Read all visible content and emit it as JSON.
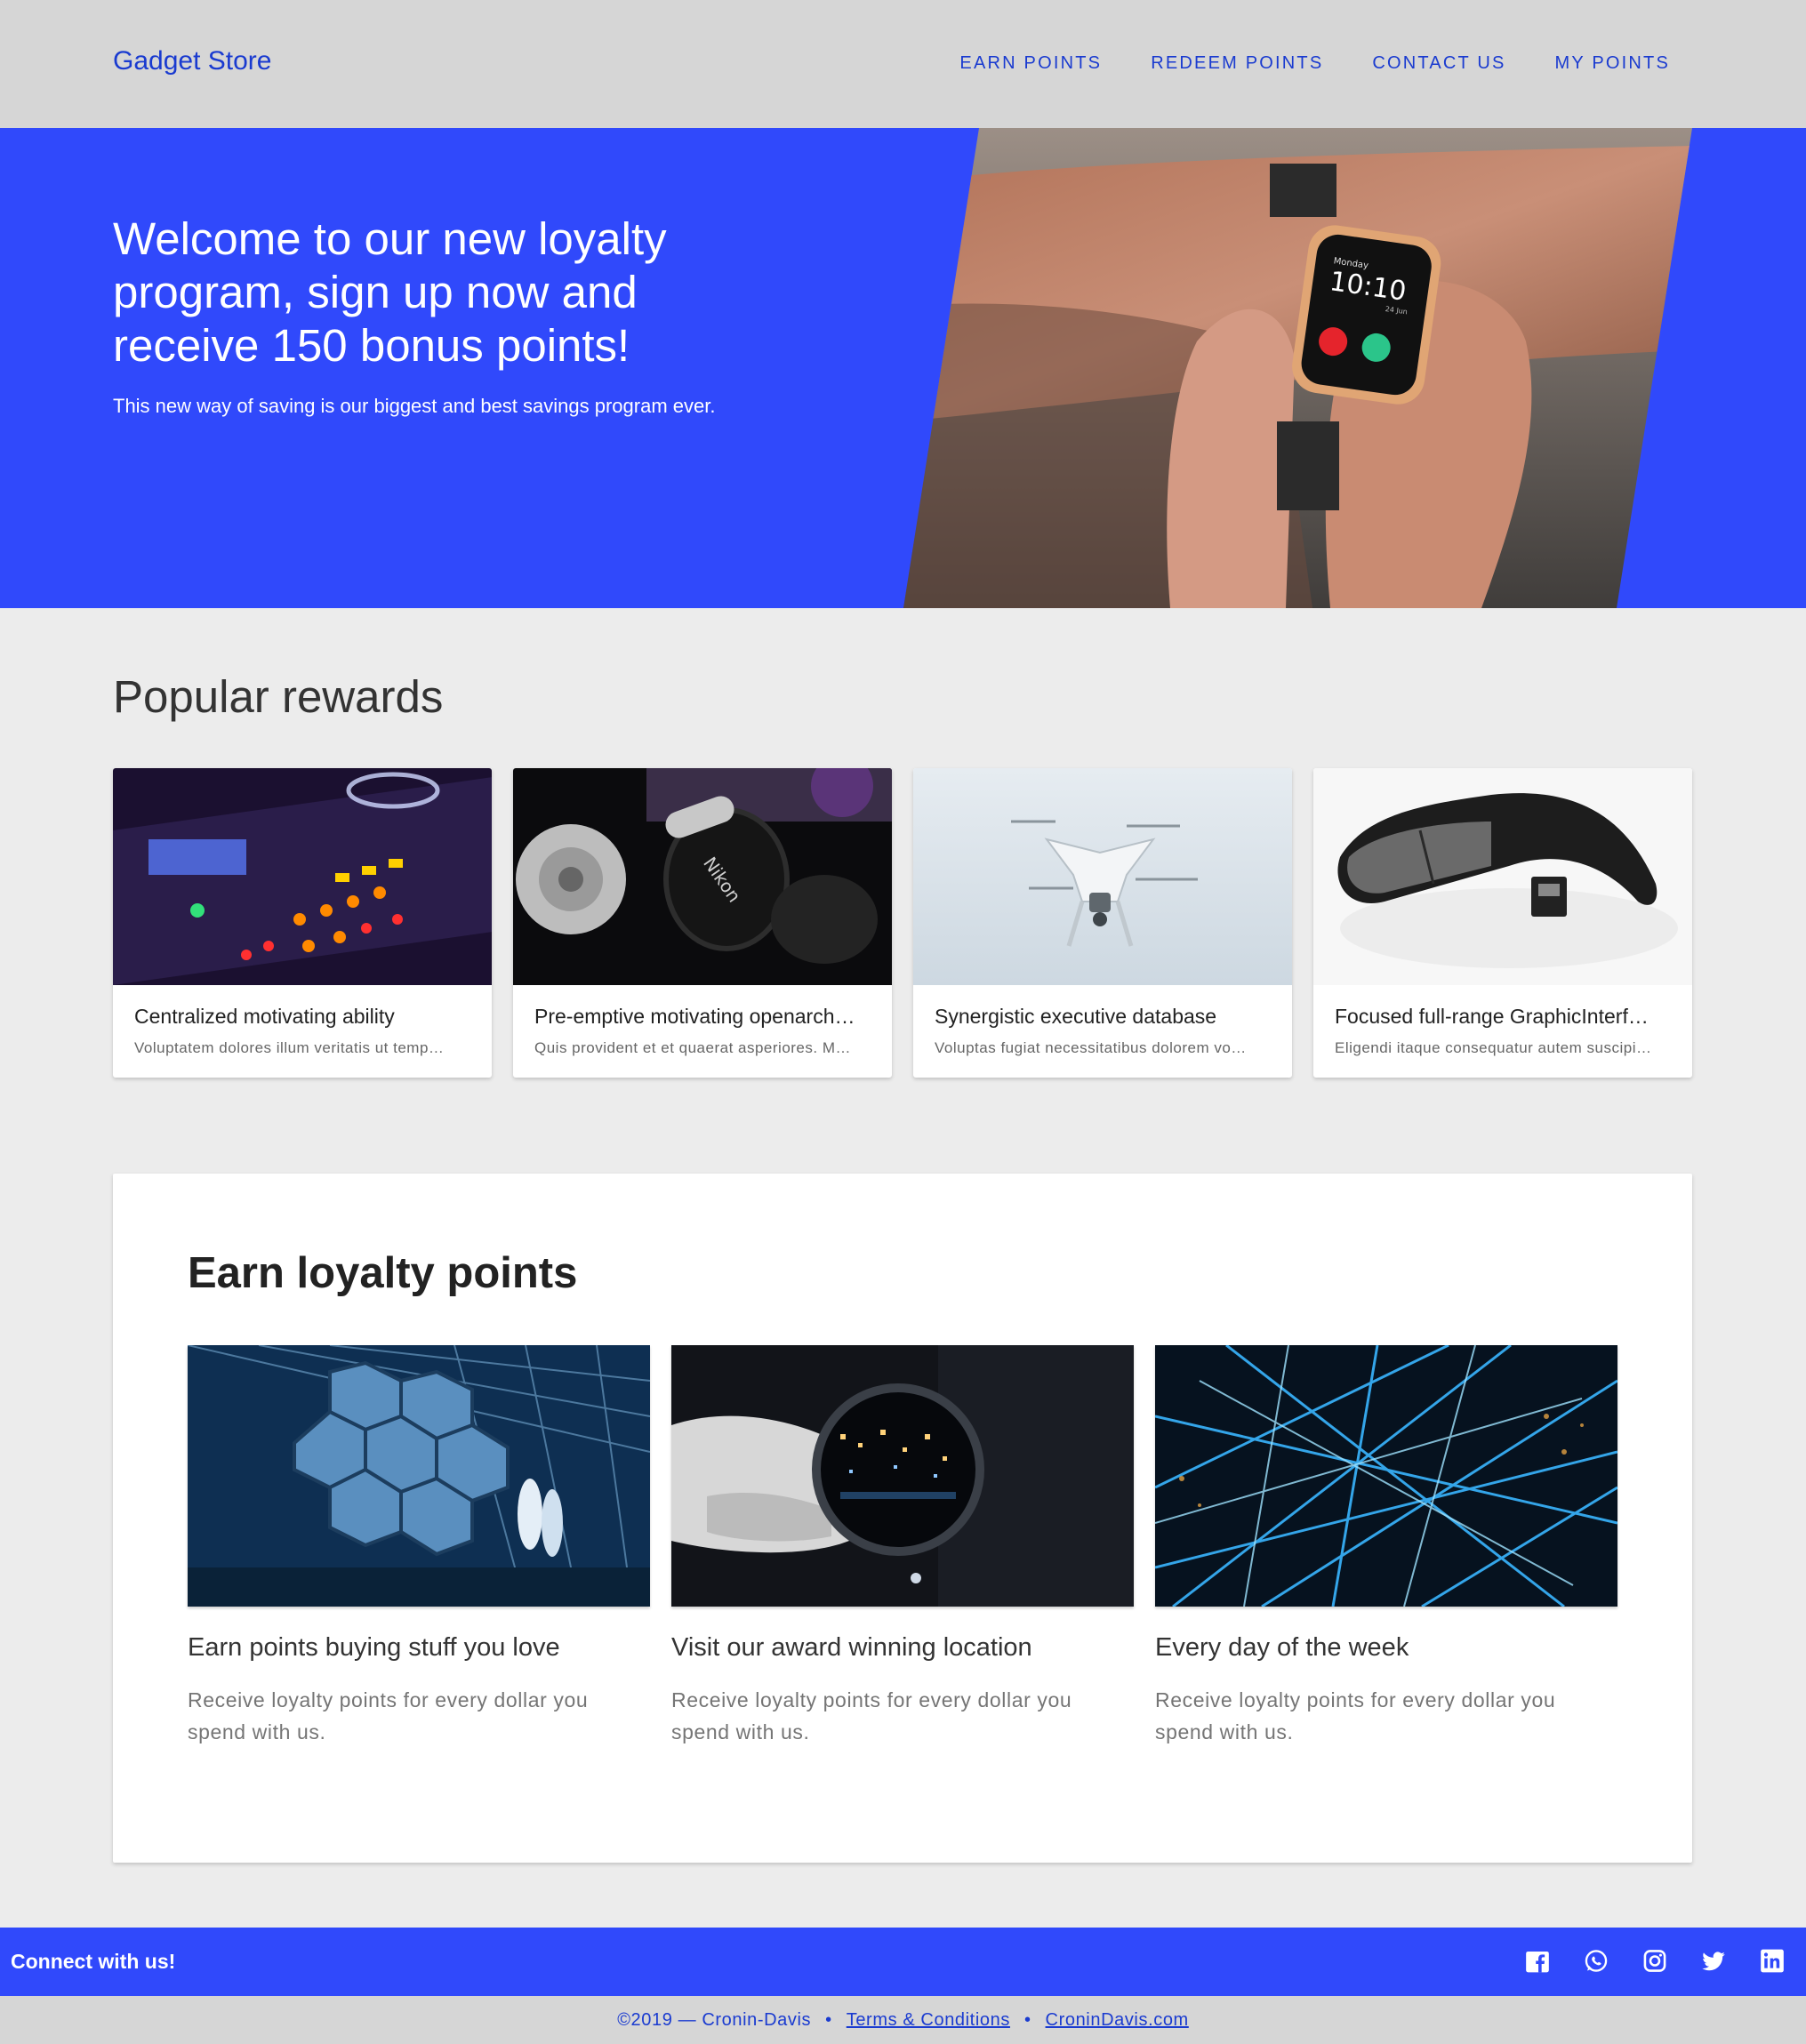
{
  "header": {
    "brand": "Gadget Store",
    "nav": [
      "Earn points",
      "Redeem points",
      "Contact us",
      "My points"
    ]
  },
  "hero": {
    "title": "Welcome to our new loyalty program, sign up now and receive 150 bonus points!",
    "subtitle": "This new way of saving is our biggest and best savings program ever.",
    "watch_day": "Monday",
    "watch_time": "10:10",
    "watch_date": "24 Jun"
  },
  "rewards": {
    "heading": "Popular rewards",
    "items": [
      {
        "title": "Centralized motivating ability",
        "desc": "Voluptatem dolores illum veritatis ut temp…",
        "image": "dj-mixer"
      },
      {
        "title": "Pre-emptive motivating openarch…",
        "desc": "Quis provident et et quaerat asperiores. M…",
        "image": "headphones-camera"
      },
      {
        "title": "Synergistic executive database",
        "desc": "Voluptas fugiat necessitatibus dolorem vo…",
        "image": "drone"
      },
      {
        "title": "Focused full-range GraphicInterf…",
        "desc": "Eligendi itaque consequatur autem suscipi…",
        "image": "wireless-mouse"
      }
    ]
  },
  "earn": {
    "heading": "Earn loyalty points",
    "items": [
      {
        "title": "Earn points buying stuff you love",
        "desc": "Receive loyalty points for every dollar you spend with us.",
        "image": "telescope-mirror"
      },
      {
        "title": "Visit our award winning location",
        "desc": "Receive loyalty points for every dollar you spend with us.",
        "image": "magnifier-city"
      },
      {
        "title": "Every day of the week",
        "desc": "Receive loyalty points for every dollar you spend with us.",
        "image": "light-network"
      }
    ]
  },
  "footer": {
    "connect": "Connect with us!",
    "social": [
      "facebook-icon",
      "whatsapp-icon",
      "instagram-icon",
      "twitter-icon",
      "linkedin-icon"
    ],
    "copyright": "©2019 — Cronin-Davis",
    "separator": "•",
    "terms": "Terms & Conditions",
    "site": "CroninDavis.com"
  },
  "colors": {
    "accent": "#3049fb",
    "link": "#1a3bd0",
    "bar": "#d6d6d6",
    "background": "#ececec"
  }
}
